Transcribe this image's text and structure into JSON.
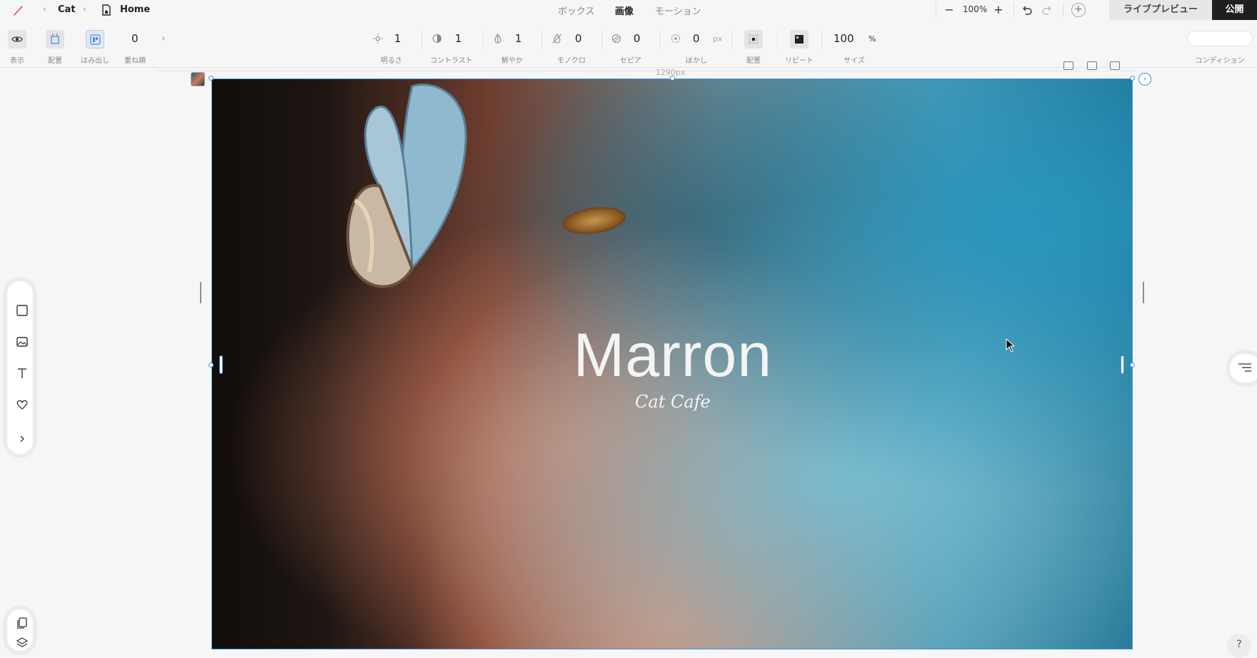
{
  "app": {
    "breadcrumb": {
      "project": "Cat",
      "page": "Home"
    }
  },
  "top_tabs": [
    {
      "label": "ボックス",
      "active": false
    },
    {
      "label": "画像",
      "active": true
    },
    {
      "label": "モーション",
      "active": false
    }
  ],
  "zoom": {
    "value": "100%"
  },
  "actions": {
    "live_preview": "ライブプレビュー",
    "publish": "公開"
  },
  "toolbar": {
    "display": {
      "caption": "表示"
    },
    "layout": {
      "caption": "配置"
    },
    "overflow": {
      "caption": "はみ出し"
    },
    "z_order": {
      "value": "0",
      "caption": "重ね順"
    },
    "brightness": {
      "value": "1",
      "caption": "明るさ"
    },
    "contrast": {
      "value": "1",
      "caption": "コントラスト"
    },
    "saturation": {
      "value": "1",
      "caption": "鮮やか"
    },
    "mono": {
      "value": "0",
      "caption": "モノクロ"
    },
    "sepia": {
      "value": "0",
      "caption": "セピア"
    },
    "blur": {
      "value": "0",
      "unit": "px",
      "caption": "ぼかし"
    },
    "image_position": {
      "caption": "配置"
    },
    "repeat": {
      "caption": "リピート"
    },
    "size": {
      "value": "100",
      "unit": "%",
      "caption": "サイズ"
    },
    "condition": {
      "caption": "コンディション"
    }
  },
  "canvas": {
    "width_label": "1290px",
    "hero": {
      "title": "Marron",
      "subtitle": "Cat Cafe"
    }
  },
  "colors": {
    "selection": "#4a90e2",
    "publish_bg": "#1f1f1f",
    "accent_logo": "#e0407a"
  },
  "palette": [
    "box-icon",
    "image-icon",
    "text-icon",
    "heart-icon",
    "chevron-right-icon"
  ],
  "palette_bottom": [
    "pages-icon",
    "layers-icon"
  ],
  "help": {
    "label": "?"
  }
}
